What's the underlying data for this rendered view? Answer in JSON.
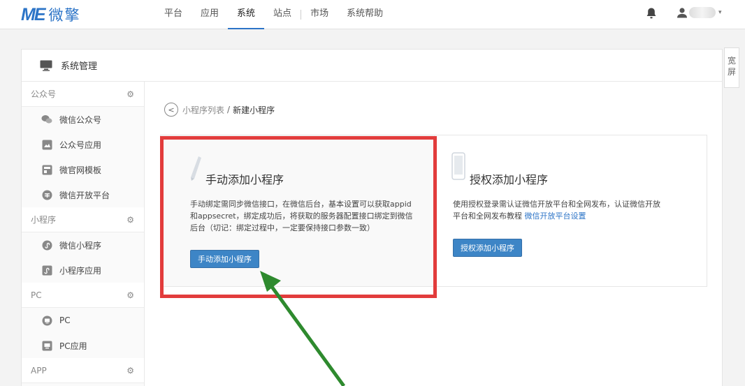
{
  "logo": {
    "mark": "ME",
    "name": "微擎"
  },
  "nav": [
    {
      "label": "平台",
      "active": false
    },
    {
      "label": "应用",
      "active": false
    },
    {
      "label": "系统",
      "active": true
    },
    {
      "label": "站点",
      "active": false
    },
    {
      "label": "市场",
      "active": false
    },
    {
      "label": "系统帮助",
      "active": false
    }
  ],
  "topbar": {
    "notification_icon": "bell-icon",
    "user_icon": "user-icon"
  },
  "wide_tab": {
    "label": "宽屏"
  },
  "panel": {
    "title": "系统管理",
    "icon": "monitor-icon"
  },
  "sidebar": {
    "groups": [
      {
        "title": "公众号",
        "items": [
          {
            "label": "微信公众号",
            "icon": "wechat-icon"
          },
          {
            "label": "公众号应用",
            "icon": "app-icon"
          },
          {
            "label": "微官网模板",
            "icon": "template-icon"
          },
          {
            "label": "微信开放平台",
            "icon": "open-platform-icon"
          }
        ]
      },
      {
        "title": "小程序",
        "items": [
          {
            "label": "微信小程序",
            "icon": "miniprogram-icon"
          },
          {
            "label": "小程序应用",
            "icon": "app-icon"
          }
        ]
      },
      {
        "title": "PC",
        "items": [
          {
            "label": "PC",
            "icon": "pc-icon"
          },
          {
            "label": "PC应用",
            "icon": "app-icon"
          }
        ]
      },
      {
        "title": "APP",
        "items": []
      }
    ]
  },
  "breadcrumb": {
    "parent": "小程序列表",
    "separator": "/",
    "current": "新建小程序"
  },
  "cards": {
    "manual": {
      "title": "手动添加小程序",
      "desc_line1": "手动绑定需同步微信接口，在微信后台，基本设置可以获取appid",
      "desc_line2": "和appsecret，绑定成功后，将获取的服务器配置接口绑定到微信",
      "desc_line3": "后台（切记：绑定过程中，一定要保持接口参数一致）",
      "button": "手动添加小程序"
    },
    "auth": {
      "title": "授权添加小程序",
      "desc_line1": "使用授权登录需认证微信开放平台和全网发布，认证微信开放",
      "desc_line2": "平台和全网发布教程",
      "desc_link": "微信开放平台设置",
      "button": "授权添加小程序"
    }
  },
  "annotation": {
    "highlight_color": "#e23c3c",
    "arrow_color": "#2e8a2e"
  },
  "colors": {
    "accent": "#2c74c7",
    "button": "#3d85c6"
  }
}
